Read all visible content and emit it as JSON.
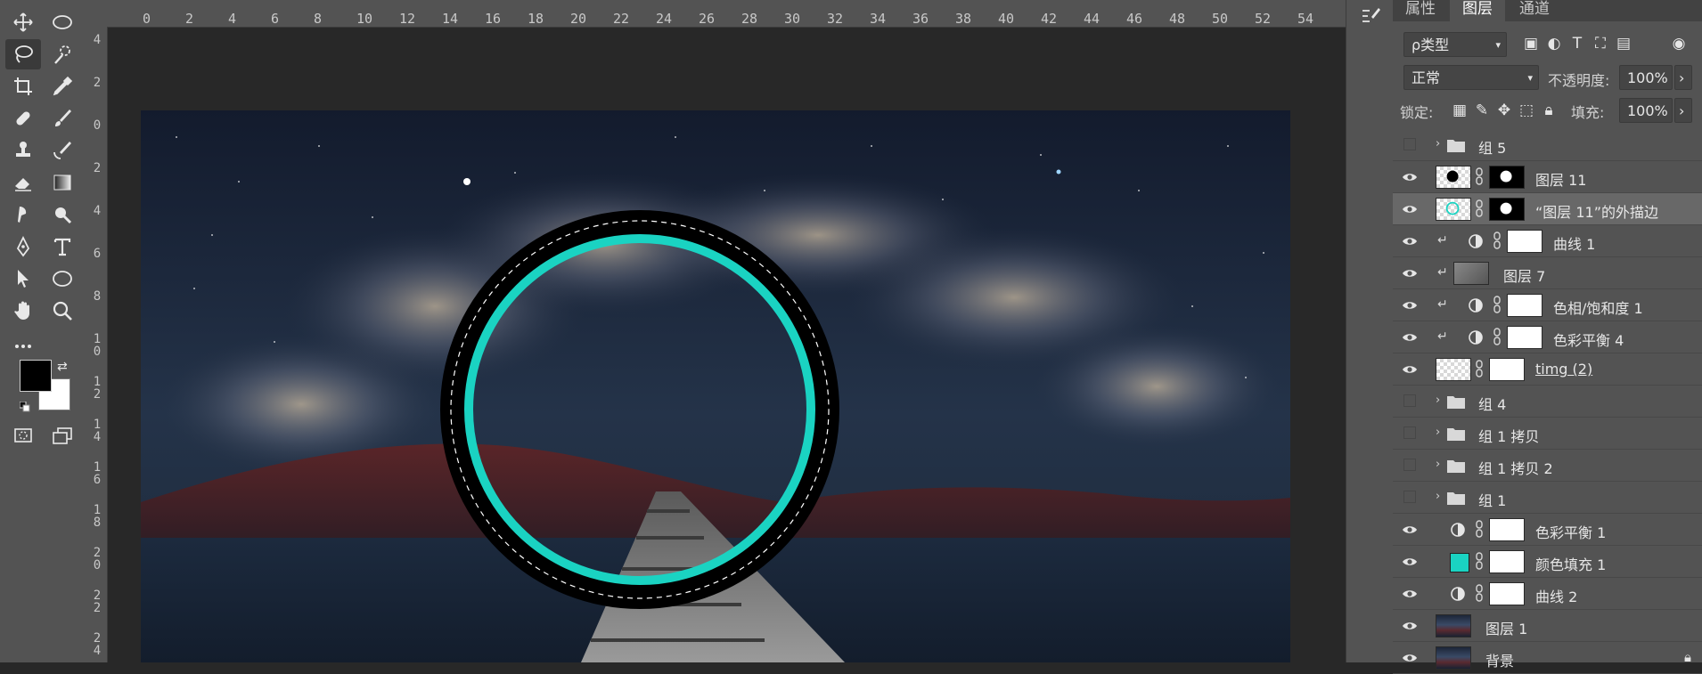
{
  "ruler": {
    "top_ticks": [
      "0",
      "2",
      "4",
      "6",
      "8",
      "10",
      "12",
      "14",
      "16",
      "18",
      "20",
      "22",
      "24",
      "26",
      "28",
      "30",
      "32",
      "34",
      "36",
      "38",
      "40",
      "42",
      "44",
      "46",
      "48",
      "50",
      "52",
      "54"
    ],
    "left_ticks": [
      "4",
      "2",
      "0",
      "2",
      "4",
      "6",
      "8",
      "1\n0",
      "1\n2",
      "1\n4",
      "1\n6",
      "1\n8",
      "2\n0",
      "2\n2",
      "2\n4"
    ]
  },
  "panel": {
    "tabs": [
      "属性",
      "图层",
      "通道"
    ],
    "active_tab": "图层",
    "filter_label": "ρ类型",
    "blend_mode": "正常",
    "opacity_label": "不透明度:",
    "opacity_value": "100%",
    "lock_label": "锁定:",
    "fill_label": "填充:",
    "fill_value": "100%"
  },
  "layers": [
    {
      "name": "组 5",
      "type": "group",
      "visible": false
    },
    {
      "name": "图层 11",
      "type": "pixel-mask",
      "visible": true
    },
    {
      "name": "“图层 11”的外描边",
      "type": "stroke",
      "visible": true,
      "selected": true
    },
    {
      "name": "曲线 1",
      "type": "adjustment",
      "visible": true,
      "clipped": true
    },
    {
      "name": "图层 7",
      "type": "pixel",
      "visible": true,
      "clipped": true
    },
    {
      "name": "色相/饱和度 1",
      "type": "adjustment",
      "visible": true,
      "clipped": true
    },
    {
      "name": "色彩平衡 4",
      "type": "adjustment",
      "visible": true,
      "clipped": true
    },
    {
      "name": "timg (2)",
      "type": "smart",
      "visible": true
    },
    {
      "name": "组 4",
      "type": "group",
      "visible": false
    },
    {
      "name": "组 1 拷贝",
      "type": "group",
      "visible": false
    },
    {
      "name": "组 1 拷贝 2",
      "type": "group",
      "visible": false
    },
    {
      "name": "组 1",
      "type": "group",
      "visible": false
    },
    {
      "name": "色彩平衡 1",
      "type": "adjustment",
      "visible": true
    },
    {
      "name": "颜色填充 1",
      "type": "fill",
      "visible": true
    },
    {
      "name": "曲线 2",
      "type": "adjustment",
      "visible": true
    },
    {
      "name": "图层 1",
      "type": "photo",
      "visible": true
    },
    {
      "name": "背景",
      "type": "photo",
      "visible": true,
      "locked": true
    }
  ],
  "colors": {
    "accent_ring": "#1ad3c2",
    "foreground": "#000000",
    "background": "#ffffff"
  }
}
